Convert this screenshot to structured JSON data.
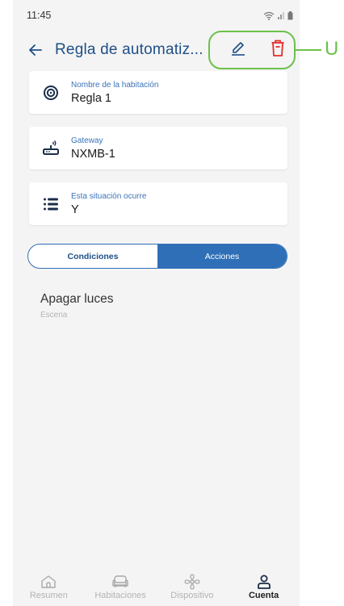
{
  "status_bar": {
    "time": "11:45"
  },
  "header": {
    "title": "Regla de automatiz..."
  },
  "cards": [
    {
      "label": "Nombre de la habitación",
      "value": "Regla 1",
      "icon": "target-icon"
    },
    {
      "label": "Gateway",
      "value": "NXMB-1",
      "icon": "router-icon"
    },
    {
      "label": "Esta situación ocurre",
      "value": "Y",
      "icon": "list-icon"
    }
  ],
  "tabs": {
    "conditions": "Condiciones",
    "actions": "Acciones",
    "active": "actions"
  },
  "action_item": {
    "title": "Apagar luces",
    "subtitle": "Escena"
  },
  "bottom_nav": {
    "items": [
      {
        "label": "Resumen",
        "icon": "home-icon"
      },
      {
        "label": "Habitaciones",
        "icon": "sofa-icon"
      },
      {
        "label": "Dispositivo",
        "icon": "fan-icon"
      },
      {
        "label": "Cuenta",
        "icon": "person-icon",
        "active": true
      }
    ]
  },
  "annotation": {
    "callout_text": "U"
  },
  "colors": {
    "primary": "#2f6fb8",
    "title": "#1d4f88",
    "delete": "#e52b2b",
    "highlight": "#6cc04a"
  }
}
